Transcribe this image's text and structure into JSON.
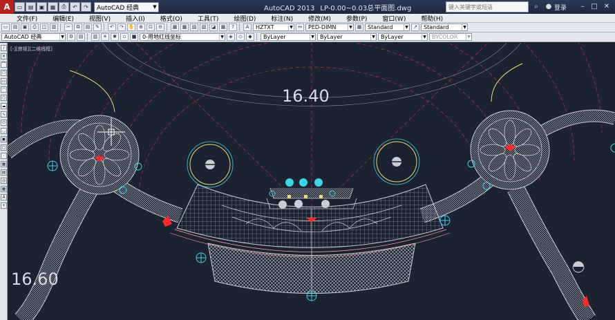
{
  "titlebar": {
    "app_logo": "A",
    "workspace": "AutoCAD 经典",
    "app_name": "AutoCAD 2013",
    "file_name": "LP-0.00~0.03总平面图.dwg",
    "search_placeholder": "键入关键字或短语",
    "login_label": "登录"
  },
  "menu": [
    "文件(F)",
    "编辑(E)",
    "视图(V)",
    "插入(I)",
    "格式(O)",
    "工具(T)",
    "绘图(D)",
    "标注(N)",
    "修改(M)",
    "参数(P)",
    "窗口(W)",
    "帮助(H)"
  ],
  "toolbar1": {
    "text_style": "HZTXT",
    "dim_style": "PED-DIMN",
    "table_style": "Standard",
    "multileader_style": "Standard"
  },
  "toolbar2": {
    "workspace": "AutoCAD 经典",
    "layer": "0-用地红线坐标",
    "color": "ByLayer",
    "linetype": "ByLayer",
    "lineweight": "ByLayer",
    "plotstyle": "BYCOLOR"
  },
  "drawing": {
    "viewport_label": "[-][俯视][二维线框]",
    "elevation_top": "16.40",
    "elevation_left": "16.60"
  },
  "colors": {
    "canvas": "#1b2230",
    "hatch": "#c9ccd2",
    "red": "#ff2a2a",
    "cyan": "#3fd3e6",
    "yellow": "#e6e07a",
    "dim_red": "#b43a3a"
  }
}
